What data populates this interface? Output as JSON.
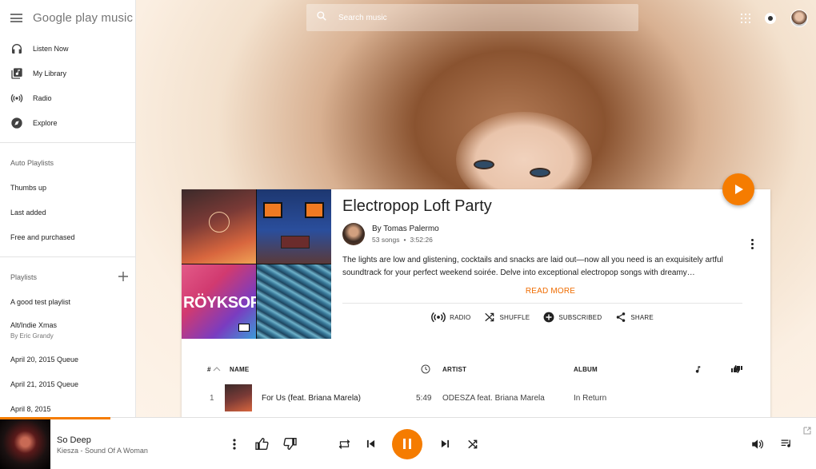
{
  "app": {
    "logo": "Google play music"
  },
  "nav": [
    {
      "label": "Listen Now",
      "icon": "headphones-icon"
    },
    {
      "label": "My Library",
      "icon": "library-icon"
    },
    {
      "label": "Radio",
      "icon": "radio-icon"
    },
    {
      "label": "Explore",
      "icon": "compass-icon"
    }
  ],
  "auto_playlists": {
    "header": "Auto Playlists",
    "items": [
      "Thumbs up",
      "Last added",
      "Free and purchased"
    ]
  },
  "playlists": {
    "header": "Playlists",
    "items": [
      {
        "label": "A good test playlist",
        "sub": ""
      },
      {
        "label": "Alt/Indie Xmas",
        "sub": "By Eric Grandy"
      },
      {
        "label": "April 20, 2015 Queue",
        "sub": ""
      },
      {
        "label": "April 21, 2015 Queue",
        "sub": ""
      },
      {
        "label": "April 8, 2015",
        "sub": ""
      }
    ]
  },
  "search": {
    "placeholder": "Search music"
  },
  "playlist": {
    "title": "Electropop Loft Party",
    "owner": "By Tomas Palermo",
    "song_count": "53 songs",
    "duration": "3:52:26",
    "description": "The lights are low and glistening, cocktails and snacks are laid out—now all you need is an exquisitely artful soundtrack for your perfect weekend soirée. Delve into exceptional electropop songs with dreamy…",
    "read_more": "READ MORE",
    "mosaic_tile3_text": "RÖYKSOPP",
    "actions": [
      {
        "label": "RADIO",
        "icon": "radio-icon"
      },
      {
        "label": "SHUFFLE",
        "icon": "shuffle-icon"
      },
      {
        "label": "SUBSCRIBED",
        "icon": "subscribed-icon"
      },
      {
        "label": "SHARE",
        "icon": "share-icon"
      }
    ]
  },
  "table": {
    "headers": {
      "num": "#",
      "name": "NAME",
      "artist": "ARTIST",
      "album": "ALBUM"
    },
    "rows": [
      {
        "num": "1",
        "name": "For Us (feat. Briana Marela)",
        "duration": "5:49",
        "artist": "ODESZA feat. Briana Marela",
        "album": "In Return"
      }
    ]
  },
  "player": {
    "title": "So Deep",
    "artist": "Kiesza - Sound Of A Woman",
    "progress": 0.135
  },
  "colors": {
    "accent": "#f57c00",
    "text": "#212121"
  }
}
